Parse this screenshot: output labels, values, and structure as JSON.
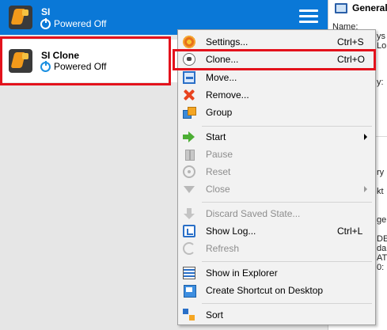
{
  "vm_list": [
    {
      "name": "SI",
      "state": "Powered Off"
    },
    {
      "name": "SI Clone",
      "state": "Powered Off"
    }
  ],
  "details": {
    "header": "General",
    "name_label": "Name:",
    "fragments": [
      "ys",
      "Lo",
      "y:",
      "ry",
      "kt",
      "ge",
      "DE",
      "da",
      "AT",
      "0:"
    ]
  },
  "context_menu": {
    "items": [
      {
        "label": "Settings...",
        "shortcut": "Ctrl+S",
        "icon": "settings-icon",
        "enabled": true
      },
      {
        "label": "Clone...",
        "shortcut": "Ctrl+O",
        "icon": "clone-icon",
        "enabled": true
      },
      {
        "label": "Move...",
        "shortcut": "",
        "icon": "move-icon",
        "enabled": true
      },
      {
        "label": "Remove...",
        "shortcut": "",
        "icon": "remove-icon",
        "enabled": true
      },
      {
        "label": "Group",
        "shortcut": "",
        "icon": "group-icon",
        "enabled": true
      },
      {
        "label": "Start",
        "shortcut": "",
        "icon": "start-icon",
        "enabled": true,
        "submenu": true
      },
      {
        "label": "Pause",
        "shortcut": "",
        "icon": "pause-icon",
        "enabled": false
      },
      {
        "label": "Reset",
        "shortcut": "",
        "icon": "reset-icon",
        "enabled": false
      },
      {
        "label": "Close",
        "shortcut": "",
        "icon": "close-icon",
        "enabled": false,
        "submenu": true
      },
      {
        "label": "Discard Saved State...",
        "shortcut": "",
        "icon": "discard-icon",
        "enabled": false
      },
      {
        "label": "Show Log...",
        "shortcut": "Ctrl+L",
        "icon": "log-icon",
        "enabled": true
      },
      {
        "label": "Refresh",
        "shortcut": "",
        "icon": "refresh-icon",
        "enabled": false
      },
      {
        "label": "Show in Explorer",
        "shortcut": "",
        "icon": "explorer-icon",
        "enabled": true
      },
      {
        "label": "Create Shortcut on Desktop",
        "shortcut": "",
        "icon": "shortcut-icon",
        "enabled": true
      },
      {
        "label": "Sort",
        "shortcut": "",
        "icon": "sort-icon",
        "enabled": true
      }
    ]
  },
  "colors": {
    "selection": "#0a78d7",
    "highlight_box": "#e3121c",
    "menu_background": "#f2f2f2"
  }
}
